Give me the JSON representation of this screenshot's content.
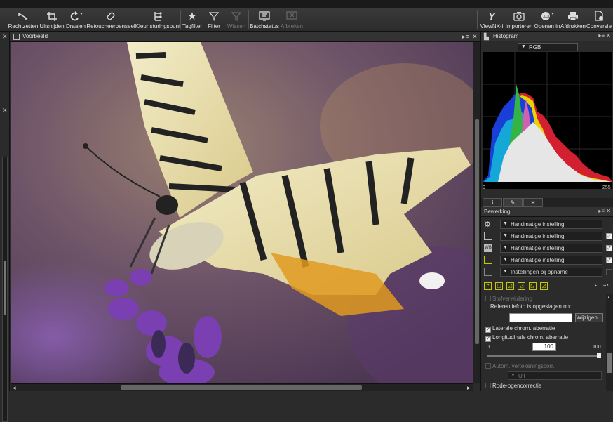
{
  "toolbar": {
    "left": [
      {
        "label": "Rechtzetten"
      },
      {
        "label": "Uitsnijden"
      },
      {
        "label": "Draaien"
      },
      {
        "label": "Retoucheerpenseel"
      },
      {
        "label": "Kleur sturingspunt"
      },
      {
        "label": "Tagfilter"
      },
      {
        "label": "Filter"
      },
      {
        "label": "Wissen"
      },
      {
        "label": "Batchstatus"
      },
      {
        "label": "Afbreken"
      }
    ],
    "right": [
      {
        "label": "ViewNX-i"
      },
      {
        "label": "Importeren"
      },
      {
        "label": "Openen in"
      },
      {
        "label": "Afdrukken"
      },
      {
        "label": "Conversie"
      }
    ]
  },
  "preview": {
    "title": "Voorbeeld"
  },
  "histogram": {
    "title": "Histogram",
    "channel": "RGB",
    "min_label": "0",
    "max_label": "255"
  },
  "edit": {
    "title": "Bewerking",
    "rows": [
      {
        "value": "Handmatige instelling",
        "checked": false,
        "has_check": false
      },
      {
        "value": "Handmatige instelling",
        "checked": true,
        "has_check": true
      },
      {
        "value": "Handmatige instelling",
        "checked": true,
        "has_check": true
      },
      {
        "value": "Handmatige instelling",
        "checked": true,
        "has_check": true
      },
      {
        "value": "Instellingen bij opname",
        "checked": false,
        "has_check": true
      }
    ],
    "tools": [
      "crop",
      "rect",
      "levels",
      "curve",
      "tone",
      "adjust"
    ],
    "options": {
      "dust": "Stofverwijdering",
      "ref_label": "Referentiefoto is opgeslagen op:",
      "ref_value": "",
      "change_btn": "Wijzigen...",
      "lateral": "Laterale chrom. aberratie",
      "longitudinal": "Longitudinale chrom. aberratie",
      "slider_min": "0",
      "slider_max": "100",
      "slider_value": "100",
      "distortion": "Autom. vertekeningscorr.",
      "distortion_value": "Uit",
      "redeye": "Rode-ogencorrectie"
    }
  },
  "colors": {
    "accent_yellow": "#d4d400",
    "panel": "#2b2b2b"
  }
}
